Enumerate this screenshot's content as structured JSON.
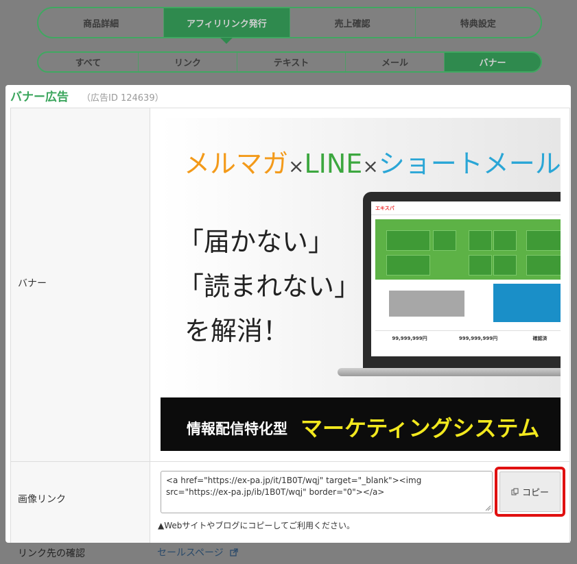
{
  "tabs_primary": [
    {
      "label": "商品詳細",
      "active": false
    },
    {
      "label": "アフィリリンク発行",
      "active": true
    },
    {
      "label": "売上確認",
      "active": false
    },
    {
      "label": "特典設定",
      "active": false
    }
  ],
  "tabs_secondary": [
    {
      "label": "すべて",
      "active": false
    },
    {
      "label": "リンク",
      "active": false
    },
    {
      "label": "テキスト",
      "active": false
    },
    {
      "label": "メール",
      "active": false
    },
    {
      "label": "バナー",
      "active": true
    }
  ],
  "modal": {
    "title": "バナー広告",
    "subtitle": "（広告ID 124639）",
    "banner_label": "バナー",
    "image_link_label": "画像リンク",
    "banner": {
      "headline_1": "メルマガ",
      "headline_x1": "×",
      "headline_2": "LINE",
      "headline_x2": "×",
      "headline_3": "ショートメール",
      "quote_1": "「届かない」",
      "quote_2": "「読まれない」",
      "quote_3": "を解消！",
      "bottom_1": "情報配信特化型",
      "bottom_2": "マーケティングシステム",
      "screen_brand": "エキスパ",
      "stat_1": "99,999,999円",
      "stat_2": "999,999,999円",
      "stat_3": "確認済"
    },
    "code_value": "<a href=\"https://ex-pa.jp/it/1B0T/wqj\" target=\"_blank\"><img src=\"https://ex-pa.jp/ib/1B0T/wqj\" border=\"0\"></a>",
    "copy_label": "コピー",
    "copy_icon": "copy-icon",
    "note": "▲Webサイトやブログにコピーしてご利用ください。"
  },
  "bottom": {
    "label": "リンク先の確認",
    "link": "セールスページ",
    "link_icon": "external-link-icon"
  },
  "colors": {
    "accent_green": "#3aa55c",
    "highlight_red": "#e01010",
    "overlay": "#7f7f7f"
  }
}
